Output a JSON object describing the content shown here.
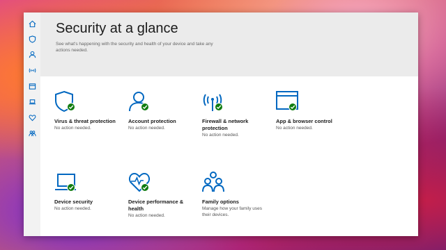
{
  "app": {
    "title": "Security at a glance",
    "subtitle": "See what's happening with the security and health of your device and take any actions needed."
  },
  "colors": {
    "accent": "#0067c0",
    "ok": "#107c10"
  },
  "rail": {
    "icons": [
      "home-icon",
      "shield-icon",
      "person-icon",
      "wifi-icon",
      "window-icon",
      "laptop-icon",
      "heart-icon",
      "family-icon"
    ]
  },
  "tiles": [
    {
      "title": "Virus & threat protection",
      "status": "No action needed.",
      "icon": "shield-icon"
    },
    {
      "title": "Account protection",
      "status": "No action needed.",
      "icon": "person-icon"
    },
    {
      "title": "Firewall & network protection",
      "status": "No action needed.",
      "icon": "antenna-icon"
    },
    {
      "title": "App & browser control",
      "status": "No action needed.",
      "icon": "browser-icon"
    },
    {
      "title": "Device security",
      "status": "No action needed.",
      "icon": "laptop-icon"
    },
    {
      "title": "Device performance & health",
      "status": "No action needed.",
      "icon": "heart-pulse-icon"
    },
    {
      "title": "Family options",
      "status": "Manage how your family uses their devices.",
      "icon": "family-icon"
    }
  ]
}
